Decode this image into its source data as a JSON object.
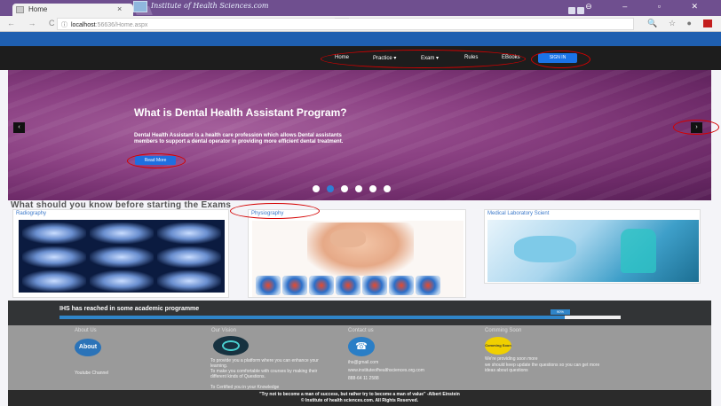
{
  "browser": {
    "tab_title": "Home",
    "tab_close": "×",
    "nav_buttons": "← → C",
    "url_info_icon": "ⓘ",
    "url_host": "localhost",
    "url_path": ":56636/Home.aspx",
    "window_controls": "⊖ – ▫ ✕",
    "address_icons": "🔍 ☆ ●"
  },
  "site": {
    "title": "Institute of Health Sciences.com",
    "nav": {
      "items": [
        "Home",
        "Practice ▾",
        "Exam ▾",
        "Rules",
        "EBooks"
      ],
      "signin": "SIGN IN"
    }
  },
  "hero": {
    "title": "What is Dental Health Assistant Program?",
    "text": "Dental Health Assistant is a health care profession which allows Dental assistants members to support a dental operator in providing more efficient dental treatment.",
    "button": "Read More",
    "prev": "‹",
    "next": "›",
    "slide_count": 6,
    "active_slide": 2
  },
  "section": {
    "title": "What should you know before starting the Exams"
  },
  "cards": [
    {
      "title": "Radiography"
    },
    {
      "title": "Physiography"
    },
    {
      "title": "Medical Laboratory Scient"
    }
  ],
  "progress": {
    "text": "IHS has reached in some academic programme",
    "percent_label": "90%",
    "value": 0.9
  },
  "footer": {
    "about": {
      "head": "About Us",
      "icon_label": "About",
      "text": "Youtube Channel"
    },
    "vision": {
      "head": "Our Vision",
      "lines": [
        "To provide you a platform where you can enhance your learning.",
        "To make you comfortable with courses by making their different kinds of Questions.",
        "To Certified you in your Knowledge"
      ]
    },
    "contact": {
      "head": "Contact us",
      "lines": [
        "ihs@gmail.com",
        "www.instituteofhealthsciences.org.com",
        "888-64 11 2588"
      ]
    },
    "coming": {
      "head": "Comming Soon",
      "icon_label": "Comming Soon",
      "lines": [
        "We're providing soon more",
        "we should keep update the questions so you can get more ideas about questions"
      ]
    },
    "quote": "\"Try not to become a man of success, but rather try to become a man of value\" -Albert Einstein",
    "copyright": "© Institute of health sciences.com. All Rights Reserved."
  },
  "colors": {
    "header_blue": "#1f5fb0",
    "nav_dark": "#1d1d1d",
    "hero_purple": "#8b4183",
    "accent_blue": "#1a73e8",
    "annotation_red": "#d40000"
  }
}
